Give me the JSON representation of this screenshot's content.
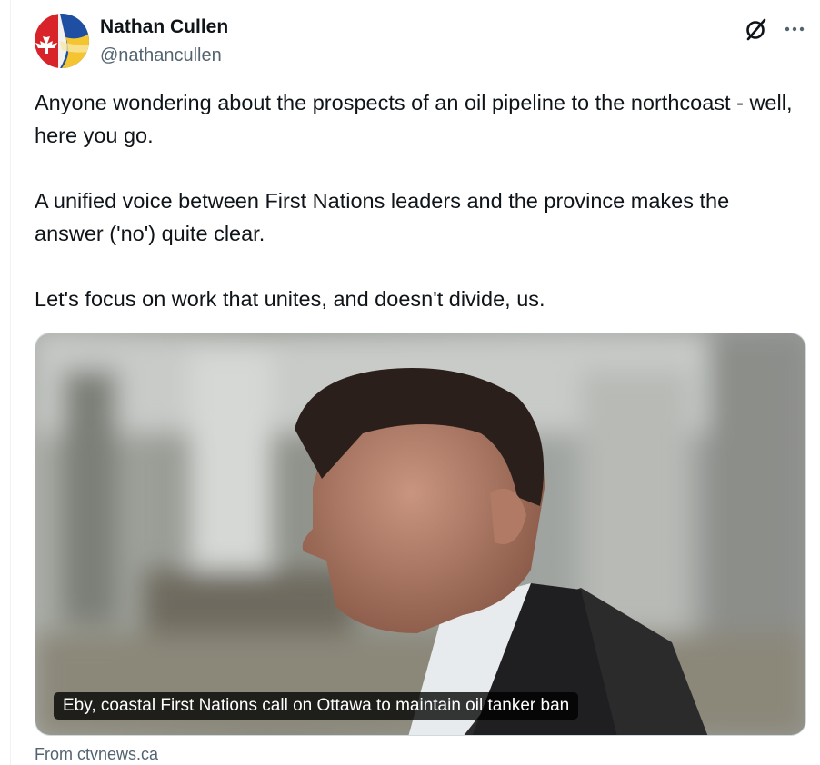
{
  "author": {
    "display_name": "Nathan Cullen",
    "handle": "@nathancullen",
    "avatar_icon": "avatar-flag-art"
  },
  "header_actions": {
    "grok_icon": "grok-slash-circle-icon",
    "more_icon": "more-horizontal-icon"
  },
  "tweet": {
    "paragraphs": [
      "Anyone wondering about the prospects of an oil pipeline to the northcoast - well, here you go.",
      "A unified voice between First Nations leaders and the province makes the answer ('no') quite clear.",
      "Let's focus on work that unites, and doesn't divide, us."
    ]
  },
  "link_card": {
    "caption": "Eby, coastal First Nations call on Ottawa to maintain oil tanker ban",
    "source": "From ctvnews.ca"
  },
  "colors": {
    "text_primary": "#0f1419",
    "text_secondary": "#536471",
    "border": "#cfd9de"
  }
}
